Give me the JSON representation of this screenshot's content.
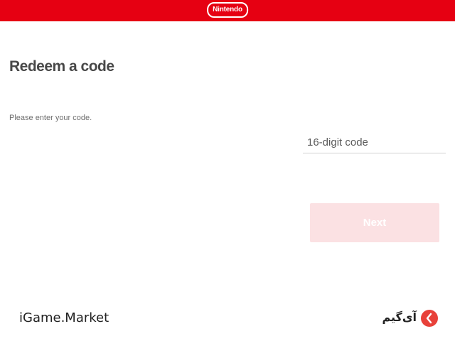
{
  "header": {
    "brand": "Nintendo",
    "bar_color": "#e60012"
  },
  "redeem": {
    "title": "Redeem a code",
    "instruction": "Please enter your code.",
    "code_placeholder": "16-digit code",
    "code_value": "",
    "next_label": "Next",
    "next_state": "disabled"
  },
  "watermarks": {
    "left": "iGame.Market",
    "right": "آی‌گیم",
    "right_logo": "red-circle-logo-icon"
  }
}
